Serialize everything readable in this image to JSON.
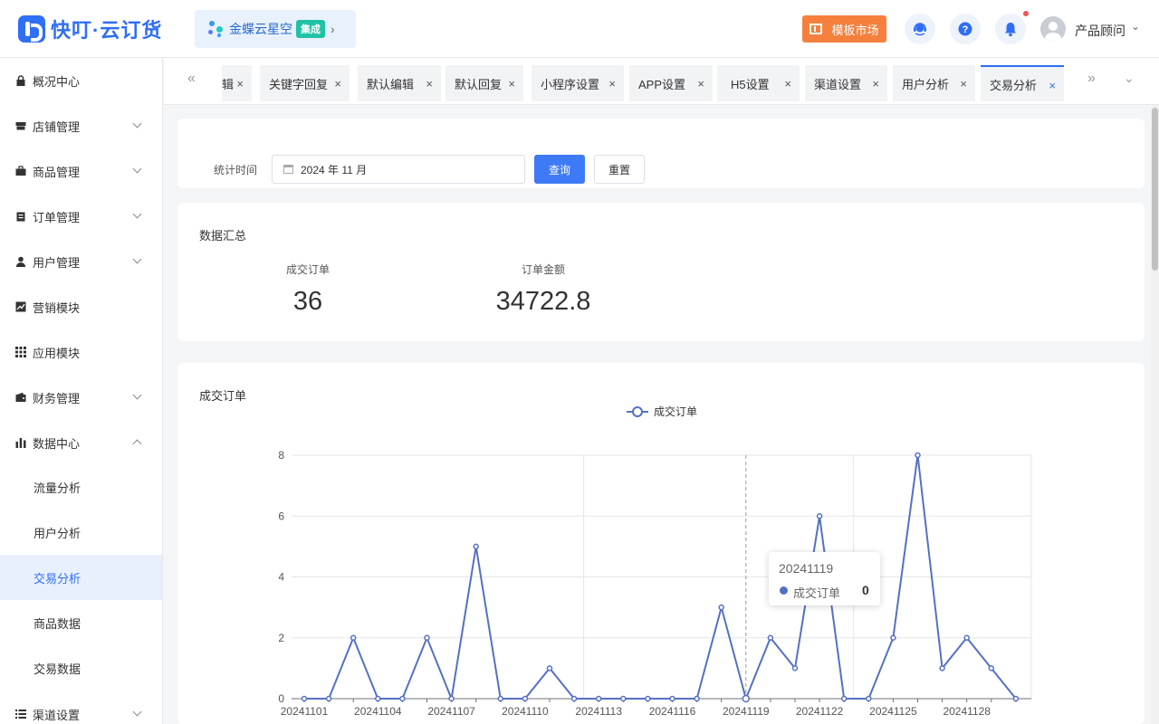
{
  "header": {
    "logo_text": "快叮·云订货",
    "brand_name": "金蝶云星空",
    "brand_badge": "集成",
    "template_button": "模板市场",
    "user_name": "产品顾问",
    "icons": [
      "service-icon",
      "help-icon",
      "bell-icon",
      "avatar"
    ]
  },
  "sidebar": {
    "items": [
      {
        "label": "概况中心",
        "icon": "lock-icon"
      },
      {
        "label": "店铺管理",
        "icon": "store-icon"
      },
      {
        "label": "商品管理",
        "icon": "briefcase-icon"
      },
      {
        "label": "订单管理",
        "icon": "clipboard-icon"
      },
      {
        "label": "用户管理",
        "icon": "user-icon"
      },
      {
        "label": "营销模块",
        "icon": "chart-line-icon"
      },
      {
        "label": "应用模块",
        "icon": "grid-icon"
      },
      {
        "label": "财务管理",
        "icon": "wallet-icon"
      },
      {
        "label": "数据中心",
        "icon": "bar-chart-icon"
      },
      {
        "label": "渠道设置",
        "icon": "list-icon"
      }
    ],
    "sub_items": [
      "流量分析",
      "用户分析",
      "交易分析",
      "商品数据",
      "交易数据"
    ]
  },
  "tabs": {
    "first_partial": "辑",
    "labels": [
      "关键字回复",
      "默认编辑",
      "默认回复",
      "小程序设置",
      "APP设置",
      "H5设置",
      "渠道设置",
      "用户分析",
      "交易分析"
    ],
    "close": "×"
  },
  "filter": {
    "label": "统计时间",
    "date_value": "2024 年 11 月",
    "query_button": "查询",
    "reset_button": "重置"
  },
  "summary": {
    "title": "数据汇总",
    "stats": [
      {
        "label": "成交订单",
        "value": "36"
      },
      {
        "label": "订单金额",
        "value": "34722.8"
      }
    ]
  },
  "chart_section": {
    "title": "成交订单"
  },
  "chart_data": {
    "type": "line",
    "legend": [
      "成交订单"
    ],
    "series": [
      {
        "name": "成交订单",
        "color": "#5470c6",
        "values": [
          0,
          0,
          2,
          0,
          0,
          2,
          0,
          5,
          0,
          0,
          1,
          0,
          0,
          0,
          0,
          0,
          0,
          3,
          0,
          2,
          1,
          6,
          0,
          0,
          2,
          8,
          1,
          2,
          1,
          0
        ]
      }
    ],
    "x": [
      "20241101",
      "20241102",
      "20241103",
      "20241104",
      "20241105",
      "20241106",
      "20241107",
      "20241108",
      "20241109",
      "20241110",
      "20241111",
      "20241112",
      "20241113",
      "20241114",
      "20241115",
      "20241116",
      "20241117",
      "20241118",
      "20241119",
      "20241120",
      "20241121",
      "20241122",
      "20241123",
      "20241124",
      "20241125",
      "20241126",
      "20241127",
      "20241128",
      "20241129",
      "20241130"
    ],
    "x_tick_labels": [
      "20241101",
      "20241104",
      "20241107",
      "20241110",
      "20241113",
      "20241116",
      "20241119",
      "20241122",
      "20241125",
      "20241128"
    ],
    "y_ticks": [
      "0",
      "2",
      "4",
      "6",
      "8"
    ],
    "ylim": [
      0,
      8
    ],
    "tooltip": {
      "date": "20241119",
      "series": "成交订单",
      "value": "0"
    }
  }
}
